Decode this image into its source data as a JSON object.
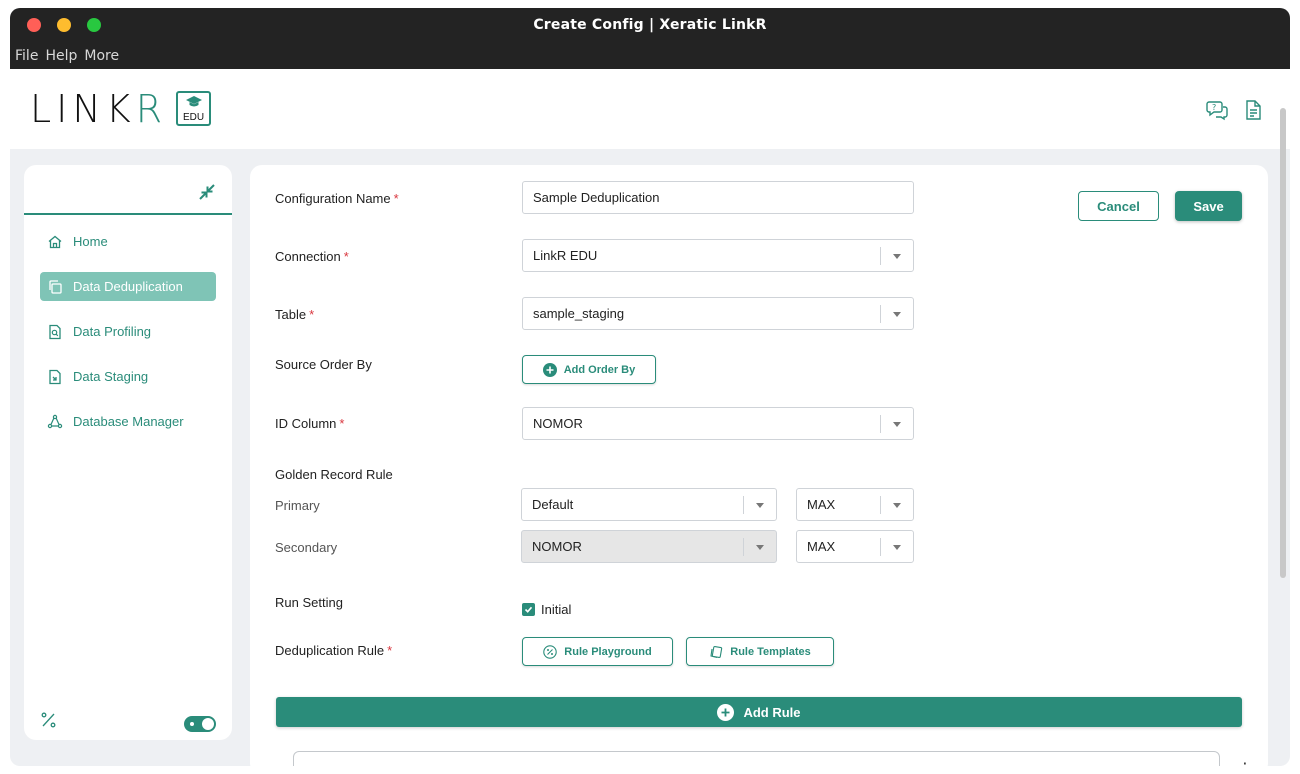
{
  "window": {
    "title": "Create Config | Xeratic LinkR",
    "menu": [
      "File",
      "Help",
      "More"
    ]
  },
  "header": {
    "logo_main": "LINK",
    "logo_r": "R",
    "logo_badge": "EDU",
    "help_icon": "help-chat-icon",
    "doc_icon": "document-icon"
  },
  "sidebar": {
    "collapse_icon": "collapse-arrows-icon",
    "items": [
      {
        "label": "Home",
        "icon": "home-icon",
        "active": false
      },
      {
        "label": "Data Deduplication",
        "icon": "copy-icon",
        "active": true
      },
      {
        "label": "Data Profiling",
        "icon": "file-search-icon",
        "active": false
      },
      {
        "label": "Data Staging",
        "icon": "file-import-icon",
        "active": false
      },
      {
        "label": "Database Manager",
        "icon": "network-icon",
        "active": false
      }
    ],
    "bottom_icon": "percent-icon",
    "theme_toggle_on": true
  },
  "form": {
    "config_name": {
      "label": "Configuration Name",
      "value": "Sample Deduplication"
    },
    "connection": {
      "label": "Connection",
      "value": "LinkR EDU"
    },
    "table": {
      "label": "Table",
      "value": "sample_staging"
    },
    "source_order": {
      "label": "Source Order By",
      "button": "Add Order By"
    },
    "id_column": {
      "label": "ID Column",
      "value": "NOMOR"
    },
    "golden": {
      "label": "Golden Record Rule",
      "primary_label": "Primary",
      "primary_value": "Default",
      "primary_agg": "MAX",
      "secondary_label": "Secondary",
      "secondary_value": "NOMOR",
      "secondary_agg": "MAX"
    },
    "run_setting": {
      "label": "Run Setting",
      "checkbox_label": "Initial",
      "checked": true
    },
    "dedup_rule": {
      "label": "Deduplication Rule",
      "playground": "Rule Playground",
      "templates": "Rule Templates"
    },
    "add_rule": "Add Rule",
    "cancel": "Cancel",
    "save": "Save",
    "required_mark": "*"
  },
  "colors": {
    "accent": "#2a8c7a",
    "active_nav": "#7fc4b6",
    "required": "#d9363e"
  }
}
